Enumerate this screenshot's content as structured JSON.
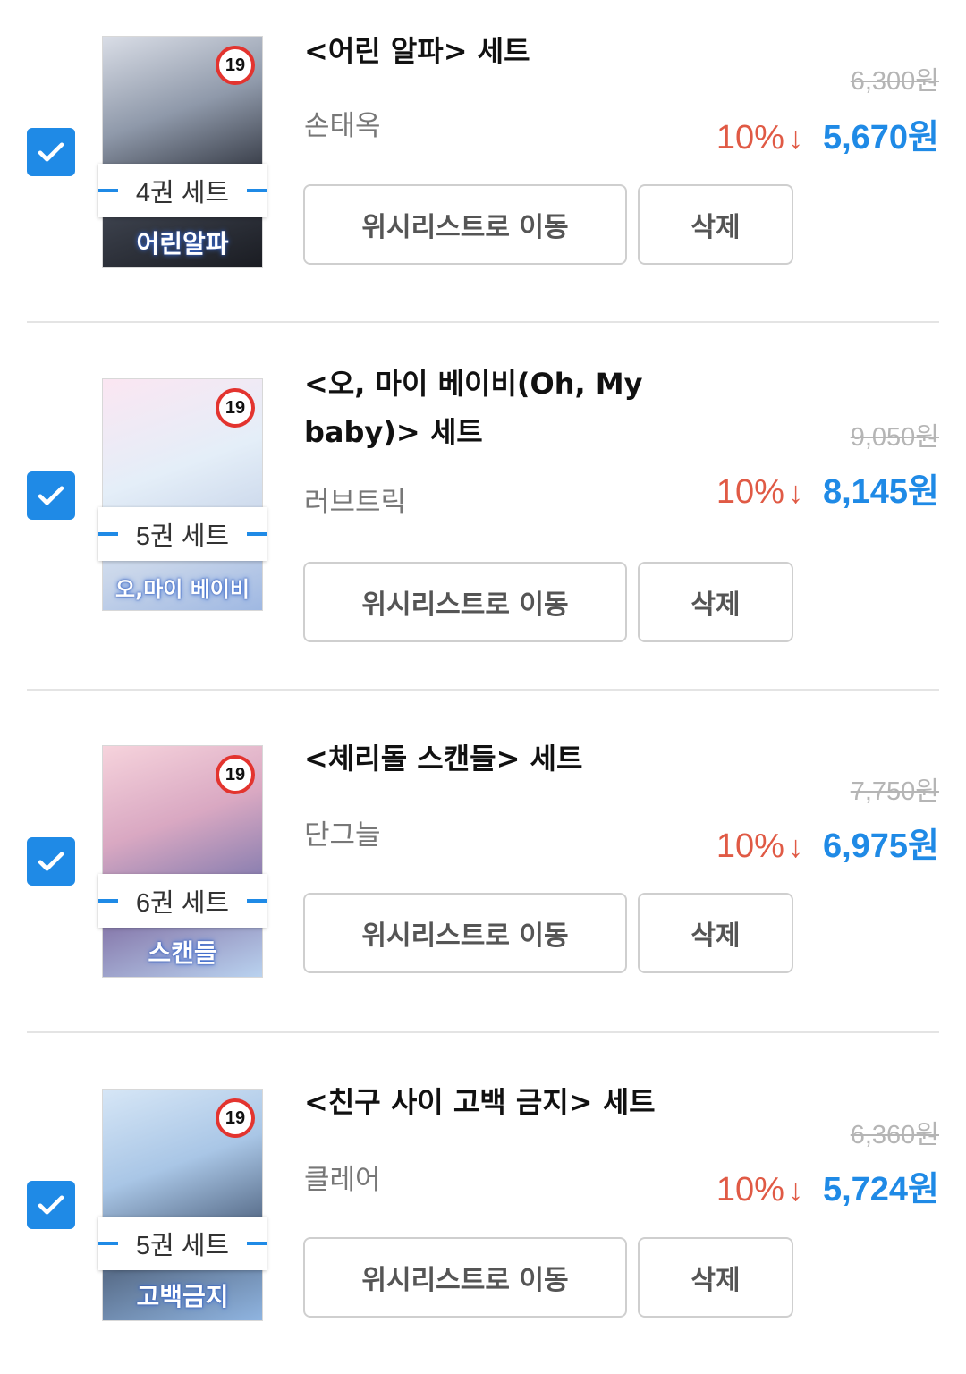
{
  "colors": {
    "accent": "#1f8ae6",
    "discount": "#e05a45",
    "badge_red": "#e3342f"
  },
  "items": [
    {
      "title": "<어린 알파> 세트",
      "author": "손태옥",
      "set_label": "4권 세트",
      "badge": "19",
      "cover_text": "어린알파",
      "original_price": "6,300원",
      "discount": "10%",
      "arrow": "↓",
      "price": "5,670원",
      "wishlist_label": "위시리스트로 이동",
      "delete_label": "삭제",
      "checked": true
    },
    {
      "title": "<오, 마이 베이비(Oh, My baby)> 세트",
      "author": "러브트릭",
      "set_label": "5권 세트",
      "badge": "19",
      "cover_text": "오,마이 베이비",
      "original_price": "9,050원",
      "discount": "10%",
      "arrow": "↓",
      "price": "8,145원",
      "wishlist_label": "위시리스트로 이동",
      "delete_label": "삭제",
      "checked": true
    },
    {
      "title": "<체리돌 스캔들> 세트",
      "author": "단그늘",
      "set_label": "6권 세트",
      "badge": "19",
      "cover_text": "스캔들",
      "original_price": "7,750원",
      "discount": "10%",
      "arrow": "↓",
      "price": "6,975원",
      "wishlist_label": "위시리스트로 이동",
      "delete_label": "삭제",
      "checked": true
    },
    {
      "title": "<친구 사이 고백 금지> 세트",
      "author": "클레어",
      "set_label": "5권 세트",
      "badge": "19",
      "cover_text": "고백금지",
      "original_price": "6,360원",
      "discount": "10%",
      "arrow": "↓",
      "price": "5,724원",
      "wishlist_label": "위시리스트로 이동",
      "delete_label": "삭제",
      "checked": true
    }
  ]
}
